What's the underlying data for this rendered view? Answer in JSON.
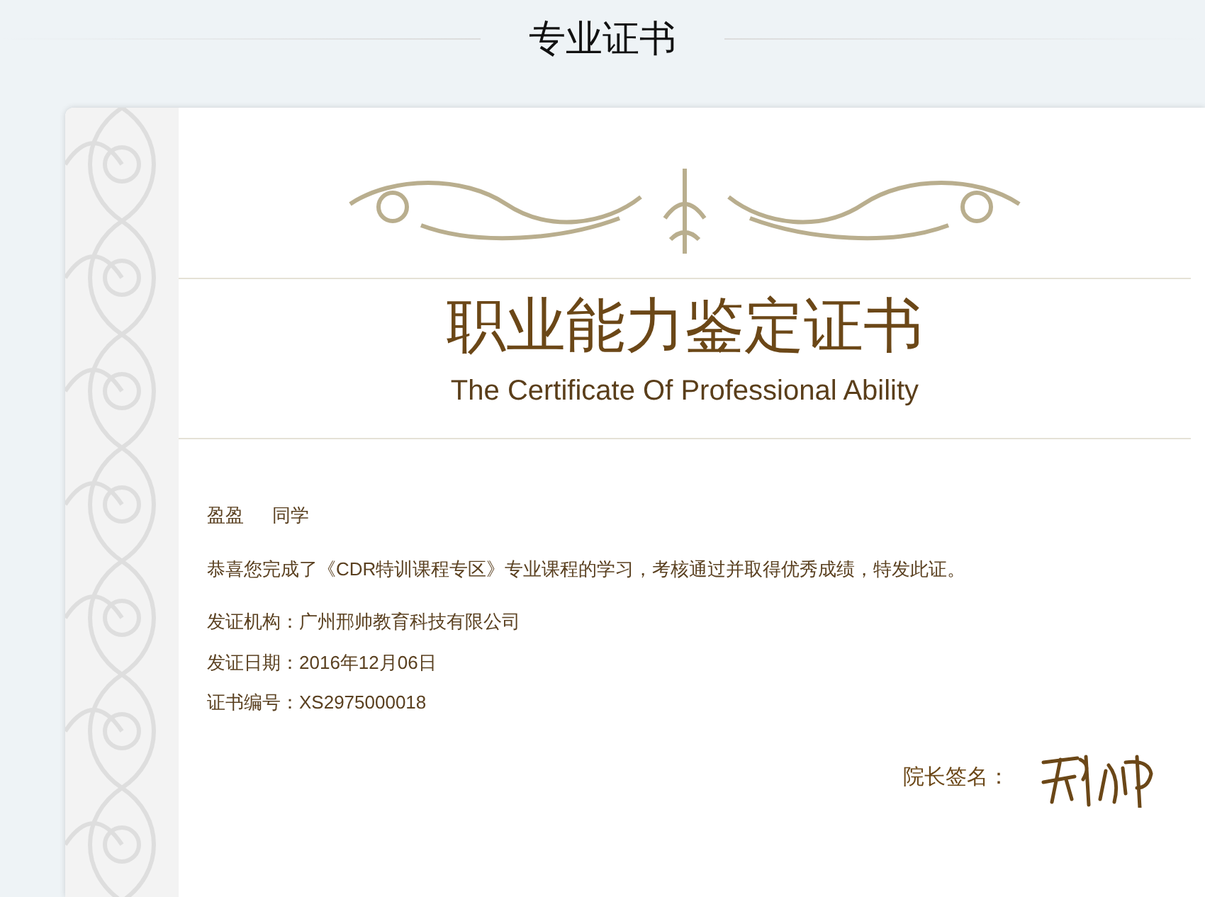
{
  "header": {
    "title": "专业证书"
  },
  "certificate": {
    "title": "职业能力鉴定证书",
    "subtitle": "The Certificate Of Professional Ability",
    "recipient": {
      "name": "盈盈",
      "suffix": "同学"
    },
    "message": "恭喜您完成了《CDR特训课程专区》专业课程的学习，考核通过并取得优秀成绩，特发此证。",
    "details": [
      "发证机构：广州邢帅教育科技有限公司",
      "发证日期：2016年12月06日",
      "证书编号：XS2975000018"
    ],
    "signature_label": "院长签名："
  }
}
